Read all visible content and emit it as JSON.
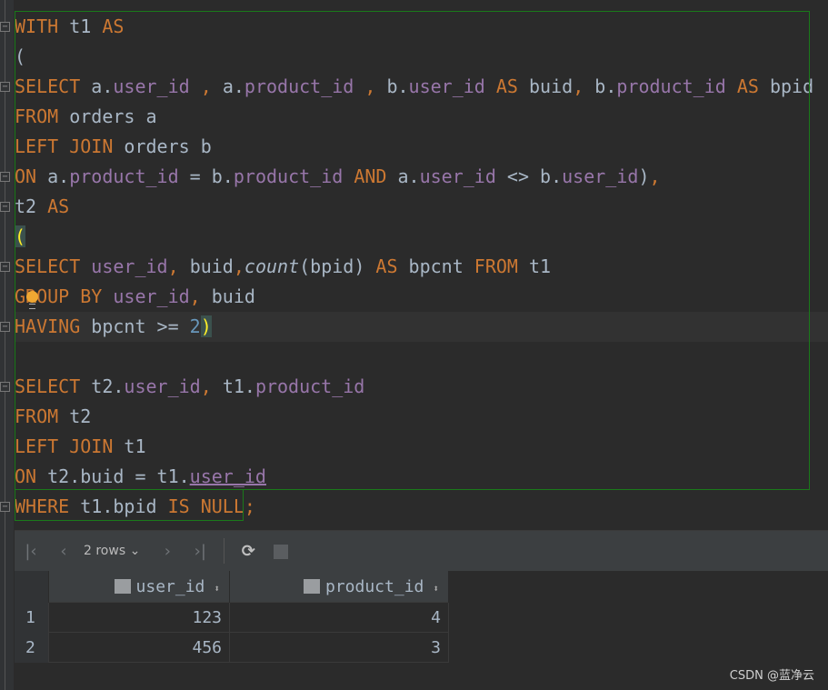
{
  "editor": {
    "lines": [
      [
        [
          "kw",
          "WITH "
        ],
        [
          "pl",
          "t1 "
        ],
        [
          "kw",
          "AS"
        ]
      ],
      [
        [
          "pl",
          "("
        ]
      ],
      [
        [
          "kw",
          "SELECT "
        ],
        [
          "pl",
          "a."
        ],
        [
          "col",
          "user_id"
        ],
        [
          "kw",
          " , "
        ],
        [
          "pl",
          "a."
        ],
        [
          "col",
          "product_id"
        ],
        [
          "kw",
          " , "
        ],
        [
          "pl",
          "b."
        ],
        [
          "col",
          "user_id"
        ],
        [
          "kw",
          " AS "
        ],
        [
          "pl",
          "buid"
        ],
        [
          "kw",
          ", "
        ],
        [
          "pl",
          "b."
        ],
        [
          "col",
          "product_id"
        ],
        [
          "kw",
          " AS "
        ],
        [
          "pl",
          "bpid"
        ]
      ],
      [
        [
          "kw",
          "FROM "
        ],
        [
          "pl",
          "orders a"
        ]
      ],
      [
        [
          "kw",
          "LEFT JOIN "
        ],
        [
          "pl",
          "orders b"
        ]
      ],
      [
        [
          "kw",
          "ON "
        ],
        [
          "pl",
          "a."
        ],
        [
          "col",
          "product_id"
        ],
        [
          "pl",
          " = b."
        ],
        [
          "col",
          "product_id"
        ],
        [
          "kw",
          " AND "
        ],
        [
          "pl",
          "a."
        ],
        [
          "col",
          "user_id"
        ],
        [
          "pl",
          " <> b."
        ],
        [
          "col",
          "user_id"
        ],
        [
          "pl",
          ")"
        ],
        [
          "kw",
          ","
        ]
      ],
      [
        [
          "pl",
          "t2 "
        ],
        [
          "kw",
          "AS"
        ]
      ],
      [
        [
          "brk",
          "("
        ]
      ],
      [
        [
          "kw",
          "SELECT "
        ],
        [
          "col",
          "user_id"
        ],
        [
          "kw",
          ", "
        ],
        [
          "pl",
          "buid"
        ],
        [
          "kw",
          ","
        ],
        [
          "fn",
          "count"
        ],
        [
          "pl",
          "(bpid) "
        ],
        [
          "kw",
          "AS "
        ],
        [
          "pl",
          "bpcnt "
        ],
        [
          "kw",
          "FROM "
        ],
        [
          "pl",
          "t1"
        ]
      ],
      [
        [
          "kw",
          "GROUP BY "
        ],
        [
          "col",
          "user_id"
        ],
        [
          "kw",
          ", "
        ],
        [
          "pl",
          "buid"
        ]
      ],
      [
        [
          "kw",
          "HAVING "
        ],
        [
          "pl",
          "bpcnt >= "
        ],
        [
          "num",
          "2"
        ],
        [
          "brk",
          ")"
        ]
      ],
      [],
      [
        [
          "kw",
          "SELECT "
        ],
        [
          "pl",
          "t2."
        ],
        [
          "col",
          "user_id"
        ],
        [
          "kw",
          ", "
        ],
        [
          "pl",
          "t1."
        ],
        [
          "col",
          "product_id"
        ]
      ],
      [
        [
          "kw",
          "FROM "
        ],
        [
          "pl",
          "t2"
        ]
      ],
      [
        [
          "kw",
          "LEFT JOIN "
        ],
        [
          "pl",
          "t1"
        ]
      ],
      [
        [
          "kw",
          "ON "
        ],
        [
          "pl",
          "t2.buid = t1."
        ],
        [
          "col ul",
          "user_id"
        ]
      ],
      [
        [
          "kw",
          "WHERE "
        ],
        [
          "pl",
          "t1.bpid "
        ],
        [
          "kw",
          "IS NULL"
        ],
        [
          "kw",
          ";"
        ]
      ]
    ]
  },
  "results": {
    "rows_label": "2 rows",
    "columns": [
      "user_id",
      "product_id"
    ],
    "rows": [
      [
        "1",
        "123",
        "4"
      ],
      [
        "2",
        "456",
        "3"
      ]
    ]
  },
  "watermark": "CSDN @蓝净云",
  "colors": {
    "keyword": "#cc7832",
    "column": "#9876aa",
    "plain": "#a9b7c6",
    "number": "#6897bb",
    "background": "#2b2b2b"
  }
}
